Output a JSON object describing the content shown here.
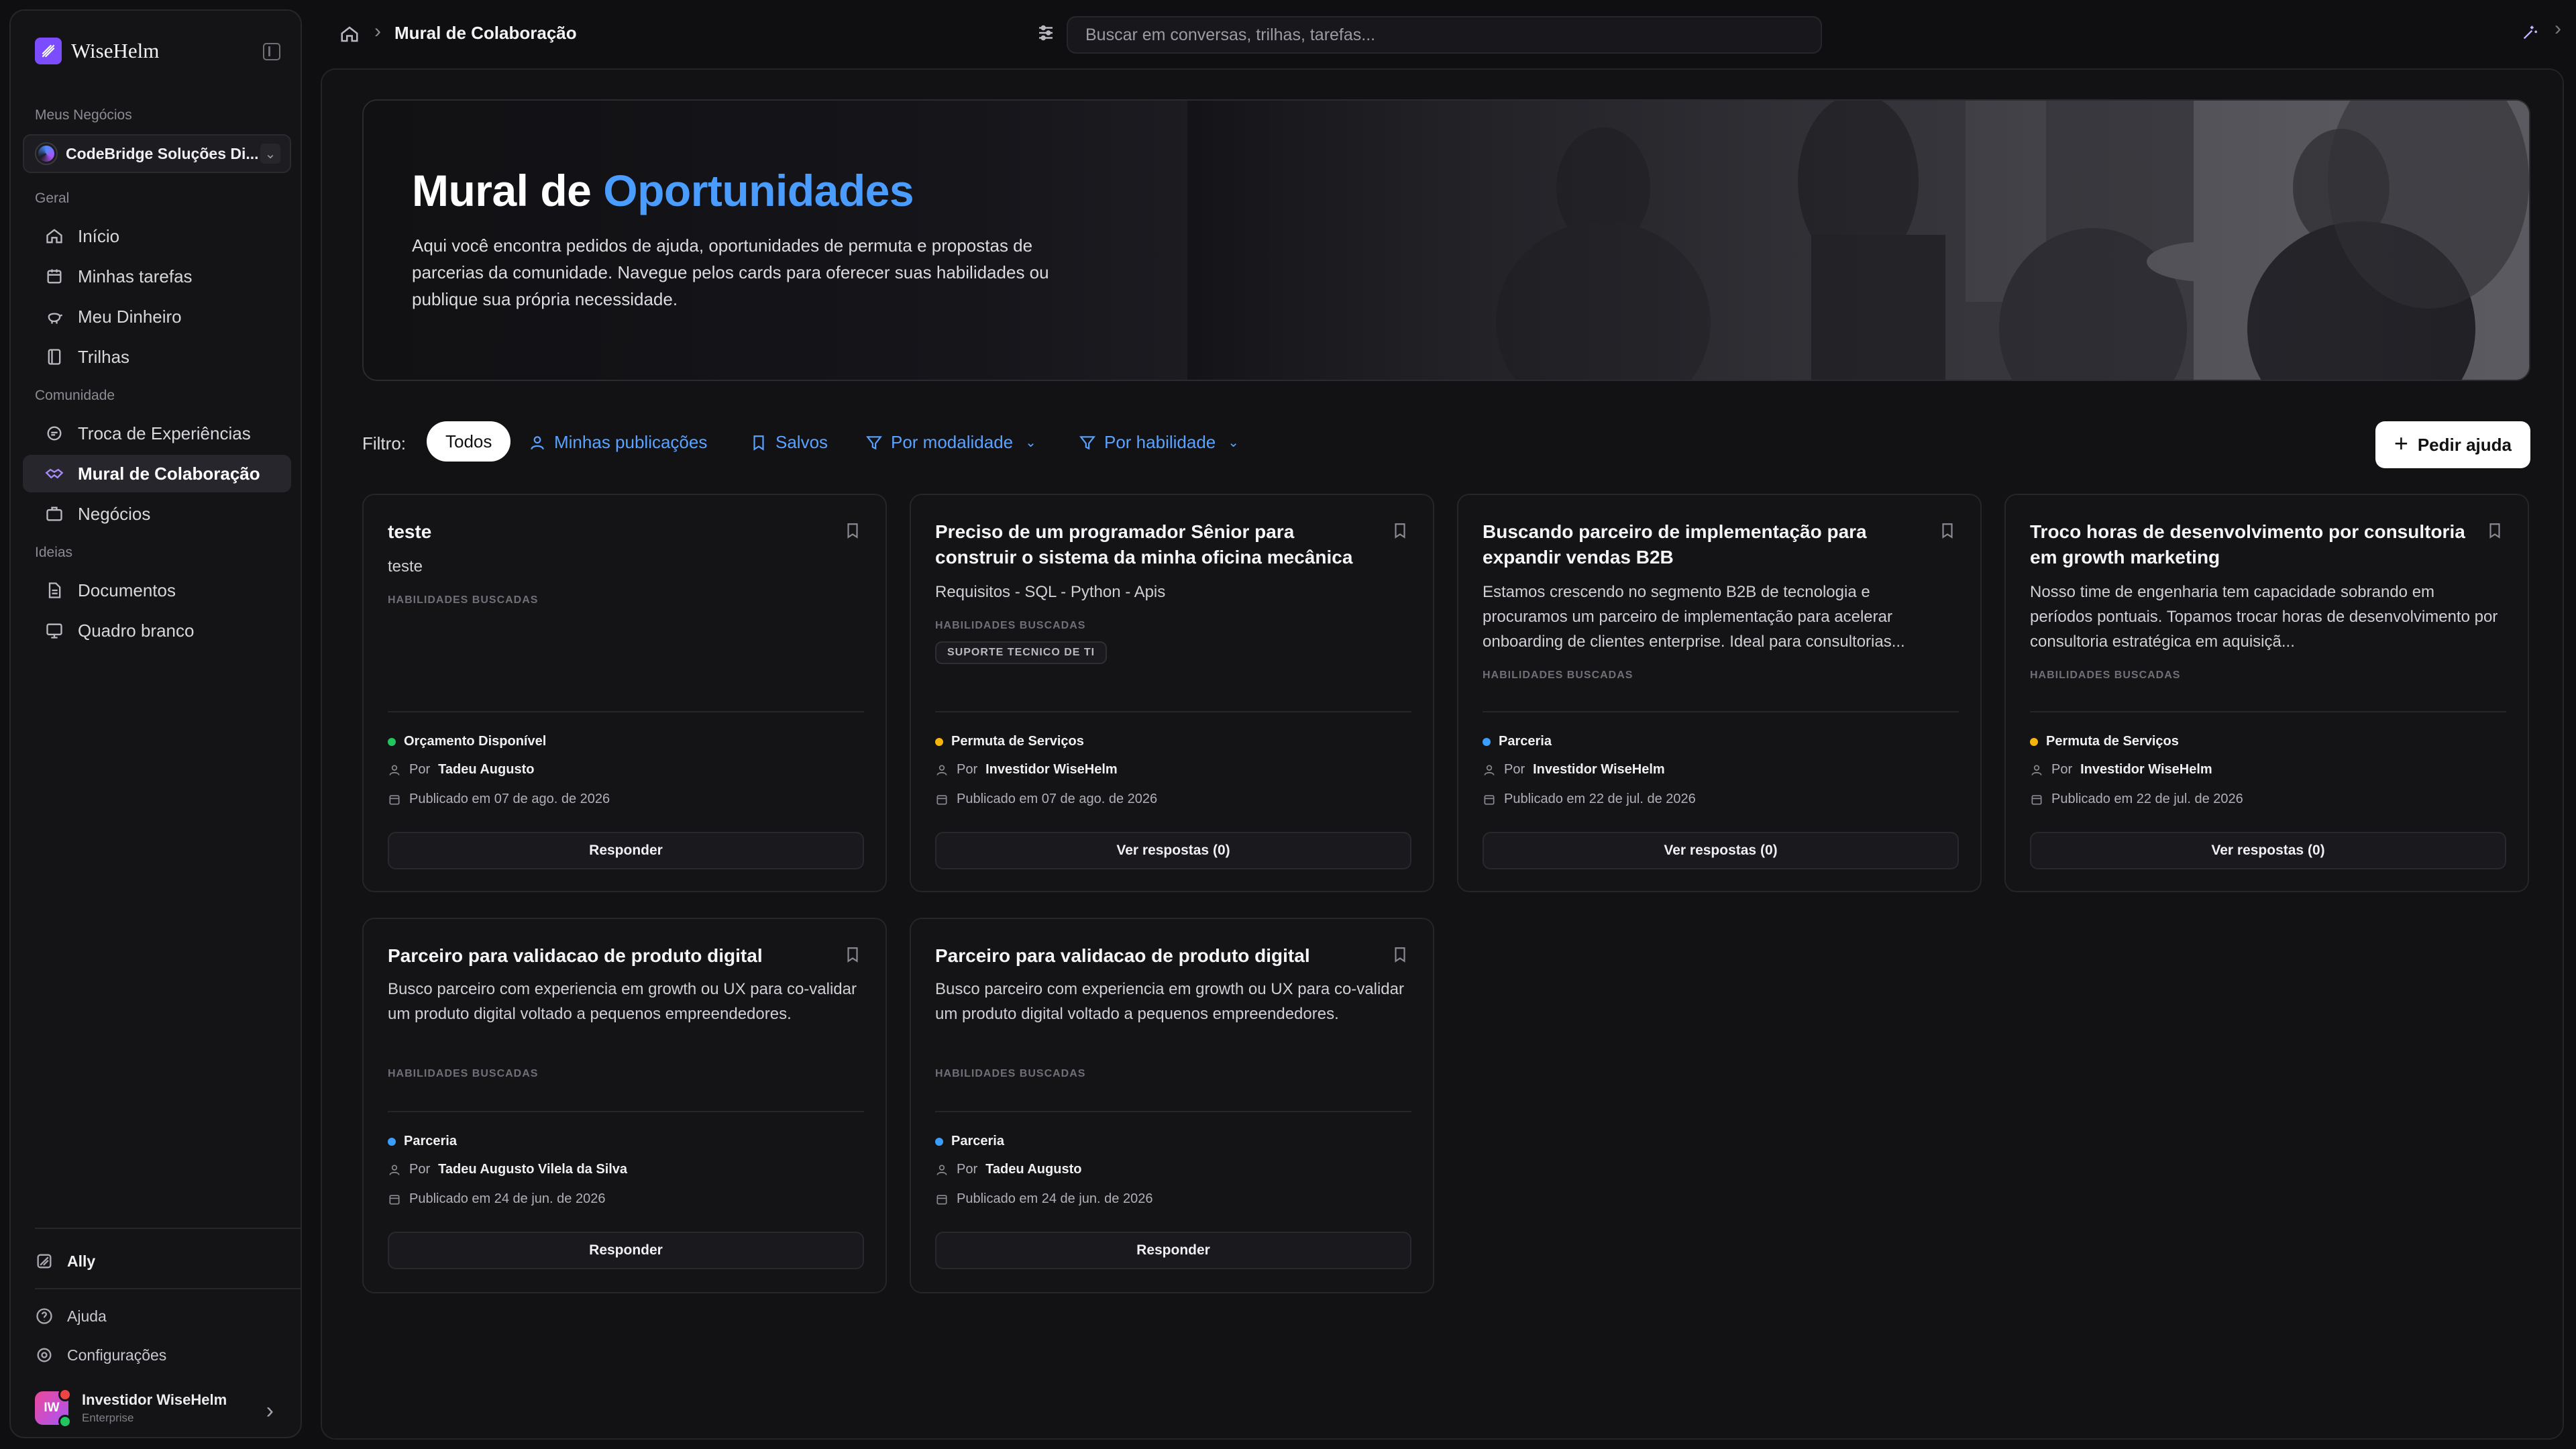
{
  "brand": {
    "name": "WiseHelm"
  },
  "sidebar": {
    "my_business_label": "Meus Negócios",
    "business_name": "CodeBridge Soluções Di...",
    "sections": {
      "geral": "Geral",
      "comunidade": "Comunidade",
      "ideias": "Ideias"
    },
    "items": [
      {
        "label": "Início",
        "icon": "home-icon"
      },
      {
        "label": "Minhas tarefas",
        "icon": "calendar-icon"
      },
      {
        "label": "Meu Dinheiro",
        "icon": "piggy-bank-icon"
      },
      {
        "label": "Trilhas",
        "icon": "book-icon"
      },
      {
        "label": "Troca de Experiências",
        "icon": "chat-icon"
      },
      {
        "label": "Mural de Colaboração",
        "icon": "handshake-icon",
        "active": true
      },
      {
        "label": "Negócios",
        "icon": "briefcase-icon"
      },
      {
        "label": "Documentos",
        "icon": "document-icon"
      },
      {
        "label": "Quadro branco",
        "icon": "whiteboard-icon"
      }
    ],
    "ally_label": "Ally",
    "help_label": "Ajuda",
    "settings_label": "Configurações",
    "user": {
      "initials": "IW",
      "name": "Investidor WiseHelm",
      "plan": "Enterprise"
    }
  },
  "topbar": {
    "breadcrumb": "Mural de Colaboração",
    "search_placeholder": "Buscar em conversas, trilhas, tarefas..."
  },
  "hero": {
    "title_prefix": "Mural de",
    "title_accent": "Oportunidades",
    "description": "Aqui você encontra pedidos de ajuda, oportunidades de permuta e propostas de parcerias da comunidade. Navegue pelos cards para oferecer suas habilidades ou publique sua própria necessidade."
  },
  "filters": {
    "label": "Filtro:",
    "all": "Todos",
    "mine": "Minhas publicações",
    "saved": "Salvos",
    "by_mode": "Por modalidade",
    "by_skill": "Por habilidade",
    "request_help": "Pedir ajuda"
  },
  "colors": {
    "accent": "#4a9cff",
    "budget": "#22c55e",
    "exchange": "#f5b50a",
    "partnership": "#3b9eff"
  },
  "cards": [
    {
      "title": "teste",
      "description": "teste",
      "skills_label": "HABILIDADES BUSCADAS",
      "tag": "",
      "type": "Orçamento Disponível",
      "type_color": "#22c55e",
      "by_prefix": "Por",
      "author": "Tadeu Augusto",
      "date": "Publicado em 07 de ago. de 2026",
      "button": "Responder"
    },
    {
      "title": "Preciso de um programador Sênior para construir o sistema da minha oficina mecânica",
      "description": "Requisitos - SQL - Python - Apis",
      "skills_label": "HABILIDADES BUSCADAS",
      "tag": "SUPORTE TECNICO DE TI",
      "type": "Permuta de Serviços",
      "type_color": "#f5b50a",
      "by_prefix": "Por",
      "author": "Investidor WiseHelm",
      "date": "Publicado em 07 de ago. de 2026",
      "button": "Ver respostas (0)"
    },
    {
      "title": "Buscando parceiro de implementação para expandir vendas B2B",
      "description": "Estamos crescendo no segmento B2B de tecnologia e procuramos um parceiro de implementação para acelerar onboarding de clientes enterprise. Ideal para consultorias...",
      "skills_label": "HABILIDADES BUSCADAS",
      "tag": "",
      "type": "Parceria",
      "type_color": "#3b9eff",
      "by_prefix": "Por",
      "author": "Investidor WiseHelm",
      "date": "Publicado em 22 de jul. de 2026",
      "button": "Ver respostas (0)"
    },
    {
      "title": "Troco horas de desenvolvimento por consultoria em growth marketing",
      "description": "Nosso time de engenharia tem capacidade sobrando em períodos pontuais. Topamos trocar horas de desenvolvimento por consultoria estratégica em aquisiçã...",
      "skills_label": "HABILIDADES BUSCADAS",
      "tag": "",
      "type": "Permuta de Serviços",
      "type_color": "#f5b50a",
      "by_prefix": "Por",
      "author": "Investidor WiseHelm",
      "date": "Publicado em 22 de jul. de 2026",
      "button": "Ver respostas (0)"
    },
    {
      "title": "Parceiro para validacao de produto digital",
      "description": "Busco parceiro com experiencia em growth ou UX para co-validar um produto digital voltado a pequenos empreendedores.",
      "skills_label": "HABILIDADES BUSCADAS",
      "tag": "",
      "type": "Parceria",
      "type_color": "#3b9eff",
      "by_prefix": "Por",
      "author": "Tadeu Augusto Vilela da Silva",
      "date": "Publicado em 24 de jun. de 2026",
      "button": "Responder"
    },
    {
      "title": "Parceiro para validacao de produto digital",
      "description": "Busco parceiro com experiencia em growth ou UX para co-validar um produto digital voltado a pequenos empreendedores.",
      "skills_label": "HABILIDADES BUSCADAS",
      "tag": "",
      "type": "Parceria",
      "type_color": "#3b9eff",
      "by_prefix": "Por",
      "author": "Tadeu Augusto",
      "date": "Publicado em 24 de jun. de 2026",
      "button": "Responder"
    }
  ]
}
